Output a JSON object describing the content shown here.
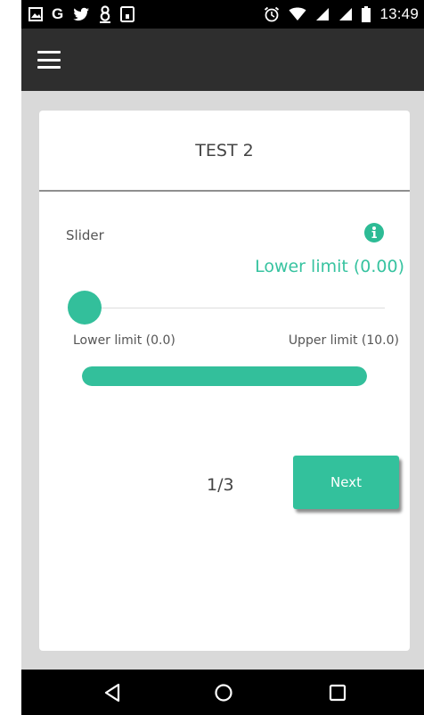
{
  "status_bar": {
    "left_icons": [
      "gallery-icon",
      "google-icon",
      "twitter-icon",
      "eight-icon",
      "download-icon"
    ],
    "right_icons": [
      "alarm-icon",
      "wifi-icon",
      "signal-icon",
      "signal-icon",
      "battery-icon"
    ],
    "google_letter": "G",
    "time": "13:49"
  },
  "app_bar": {
    "menu_icon": "menu-icon"
  },
  "card": {
    "title": "TEST 2",
    "slider_label": "Slider",
    "info_icon": "info-icon",
    "current_value_text": "Lower limit (0.00)",
    "slider": {
      "min": 0.0,
      "max": 10.0,
      "value": 0.0
    },
    "range_min_label": "Lower limit (0.0)",
    "range_max_label": "Upper limit (10.0)",
    "progress_fraction": 1.0,
    "page_indicator": "1/3",
    "next_label": "Next"
  },
  "nav_bar": {
    "icons": [
      "back-icon",
      "home-icon",
      "recents-icon"
    ]
  },
  "colors": {
    "accent": "#33bf9b",
    "value_text": "#37c3a0",
    "status_bar": "#000000",
    "app_bar": "#2e2e2e",
    "background": "#d9d9d9"
  }
}
